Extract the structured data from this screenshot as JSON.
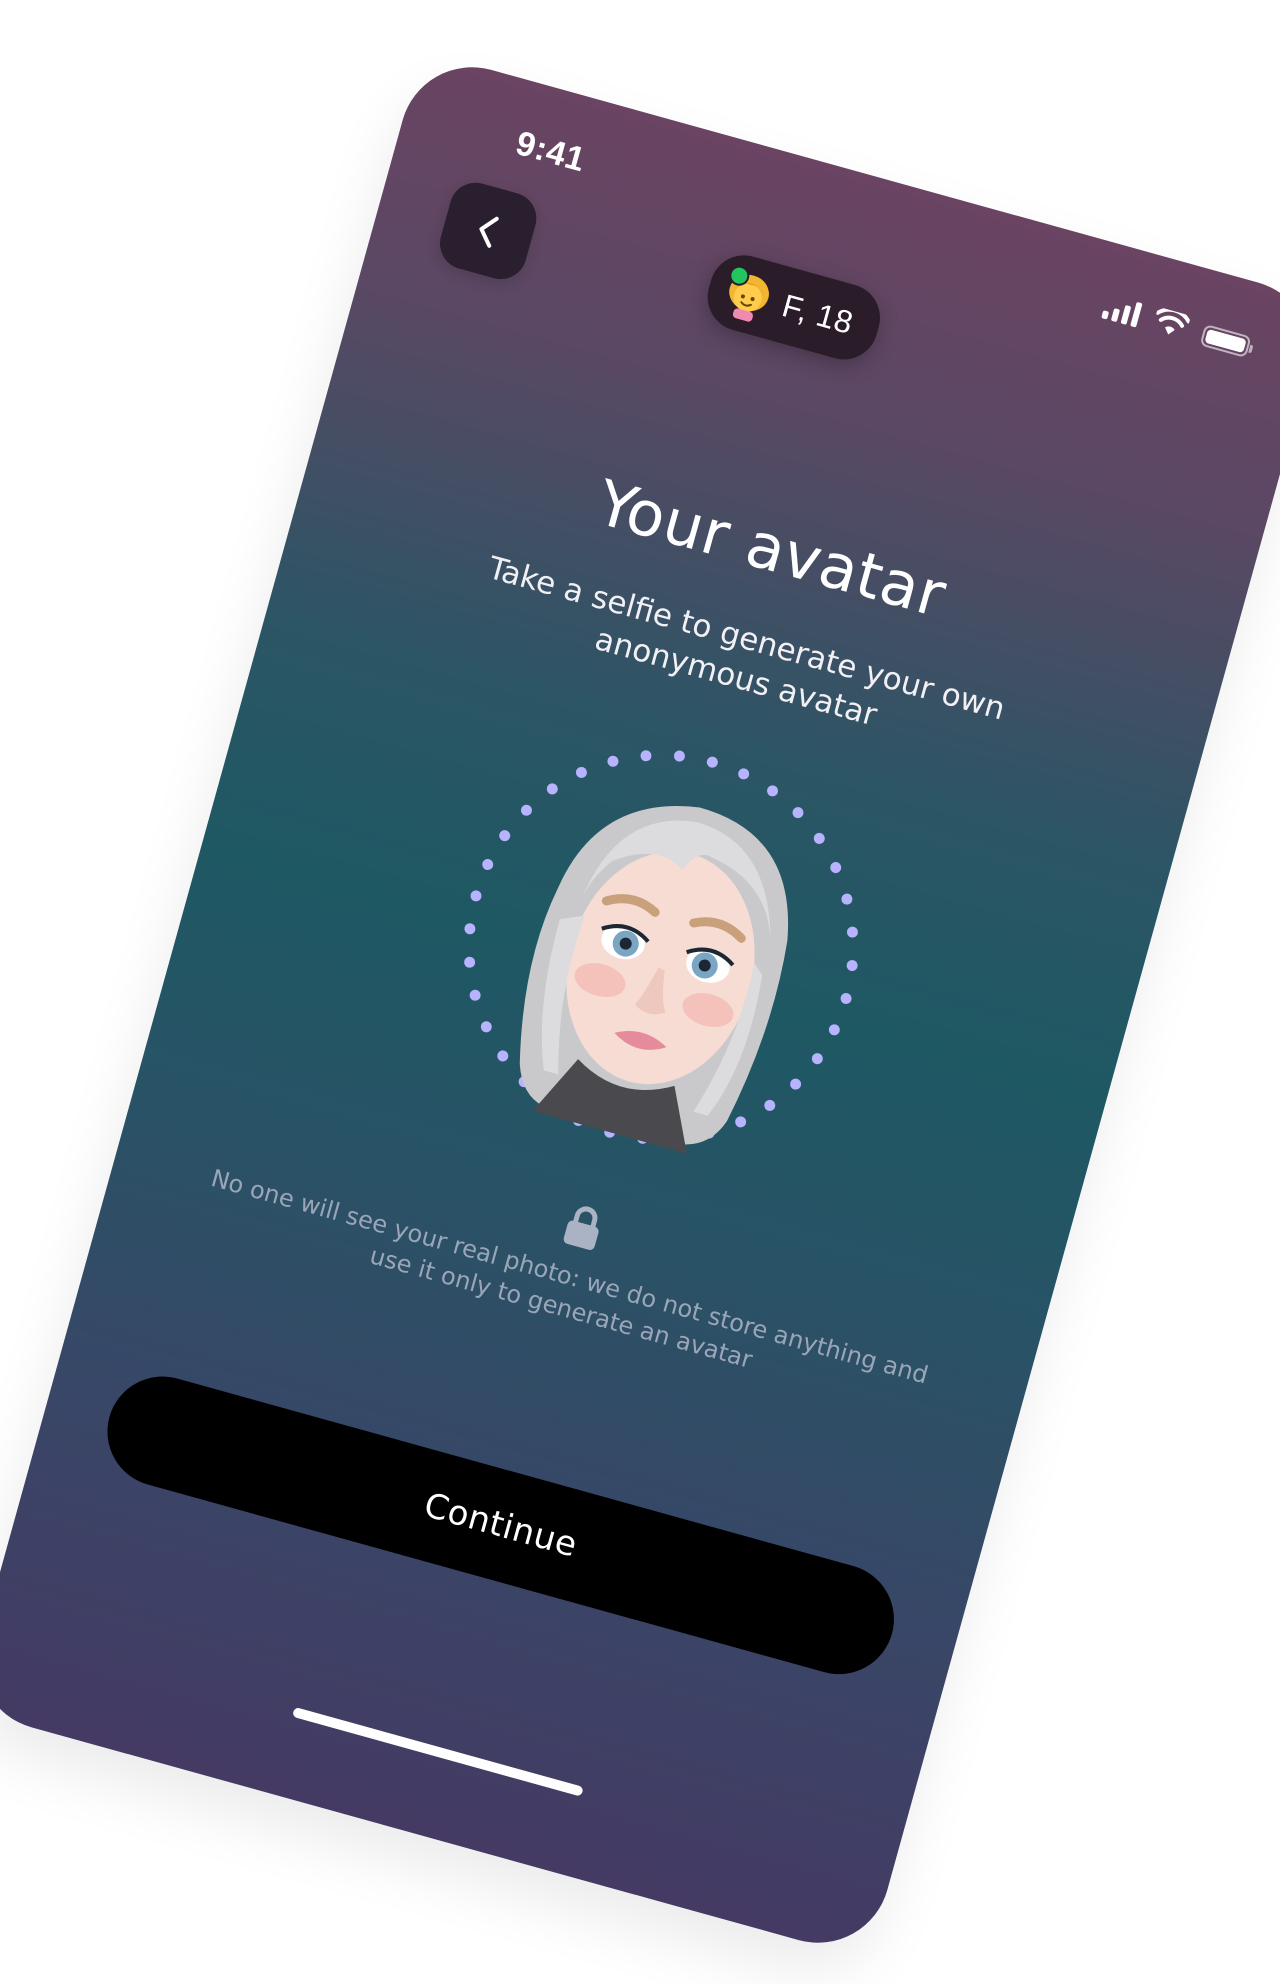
{
  "status_bar": {
    "time": "9:41",
    "signal_icon": "cellular-signal-icon",
    "wifi_icon": "wifi-icon",
    "battery_icon": "battery-icon"
  },
  "header": {
    "back_icon": "chevron-left-icon",
    "profile_chip": {
      "emoji": "👧",
      "online_color": "#22c55e",
      "label": "F, 18"
    }
  },
  "main": {
    "title": "Your avatar",
    "subtitle": "Take a selfie to generate your own anonymous avatar",
    "avatar": {
      "image_icon": "memoji-avatar-icon",
      "ring_color": "#b7b3ff"
    },
    "privacy": {
      "icon": "lock-icon",
      "text": "No one will see your real photo: we do not store anything and use it only to generate an avatar"
    }
  },
  "footer": {
    "continue_label": "Continue"
  },
  "colors": {
    "gradient_top": "#6a4462",
    "gradient_mid": "#1e5863",
    "gradient_bottom": "#443a63",
    "button_bg": "#000000",
    "chip_bg": "#2a1d29"
  }
}
